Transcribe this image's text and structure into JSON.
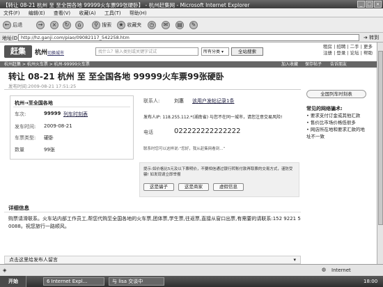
{
  "window": {
    "title": "【转让 08-21 杭州 至 至全国各地 99999火车票99张硬卧】 - 杭州赶集网 - Microsoft Internet Explorer"
  },
  "menu": [
    "文件(F)",
    "编辑(E)",
    "查看(V)",
    "收藏(A)",
    "工具(T)",
    "帮助(H)"
  ],
  "toolbar": {
    "back": "后退",
    "search": "搜索",
    "favorites": "收藏夹"
  },
  "address": {
    "label": "地址(D)",
    "url": "http://hz.ganji.com/piao/09082117_542258.htm",
    "go": "转到"
  },
  "site": {
    "logo": "赶集",
    "city": "杭州",
    "switch_city": "切换城市",
    "search_placeholder": "找什么？输入类别或关键字试试",
    "category": "所有分类",
    "search_button": "全站搜索",
    "top_links_1": "租房 | 招聘 | 二手 | 更多",
    "top_links_2": "注册 | 登录 | 论坛 | 帮助"
  },
  "nav": {
    "breadcrumb": "杭州赶集 > 杭州火车票 > 杭州-99999火车票",
    "add_favorite": "加入收藏",
    "save_post": "保存帖子",
    "report": "告诉朋友"
  },
  "post": {
    "title": "转让 08-21 杭州 至 至全国各地 99999火车票99张硬卧",
    "date": "发布时间:2009-08-21 17:51:25",
    "route": "杭州→至全国各地",
    "train_label": "车次:",
    "train_value": "99999",
    "train_link": "列车时刻表",
    "depart_label": "发车时间:",
    "depart_value": "2009-08-21",
    "seat_label": "车票类型:",
    "seat_value": "硬卧",
    "qty_label": "数量",
    "qty_value": "99张",
    "contact_label": "联系人:",
    "contact_value": "刘惠",
    "contact_link": "该用户发帖记录1条",
    "ip_text": "发布人IP: 118.255.112.*(湖南省) 与您不在同一城市，请您注意交易风险!",
    "phone_label": "电话",
    "phone_value": "022222222222222",
    "tip_text": "联系时您可以这样说:“您好，我从赶集网看到...”",
    "notice_text": "提示:如价格比5元及以下票明价，不要相信通过银行转账付款再取票的交易方式，谨防受骗! 如发现请立即举报",
    "btn_liar": "这是骗子",
    "btn_agent": "这是商家",
    "btn_fake": "虚假信息",
    "detail_heading": "详细信息",
    "detail_text": "购票请滑联系。火车站内部工作员工,帮您代购至全国各地的火车票,团体票,学生票,往返票,直接从窗口出票,有需要的请联系:152 9221 5 0088。祝您旅行一路顺风。",
    "message_bar": "点击这里给发布人留言"
  },
  "sidebar": {
    "button": "全国列车时刻表",
    "heading": "常见的网络骗术:",
    "items": [
      "• 要求支付订金或其他汇款",
      "• 售价比市场价格低很多",
      "• 网店所在地和要求汇款的地",
      "  址不一致"
    ]
  },
  "status": {
    "zone": "Internet"
  },
  "taskbar": {
    "start": "开始",
    "tasks": [
      "6 Internet Expl...",
      "与 lisa 交谈中"
    ],
    "clock": "18:00"
  }
}
